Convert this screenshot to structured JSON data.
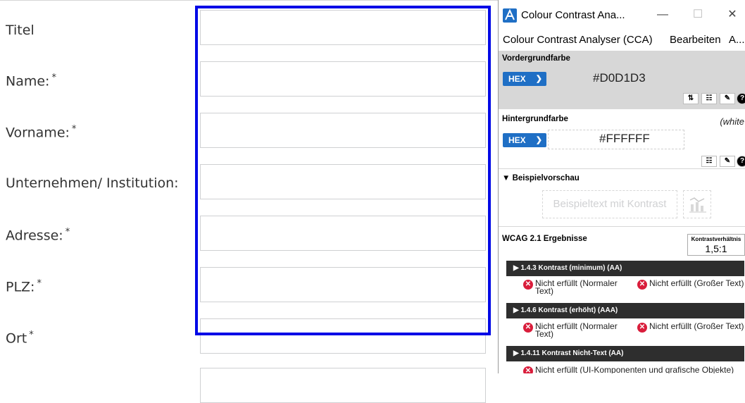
{
  "form": {
    "fields": [
      {
        "label": "Titel",
        "required": false
      },
      {
        "label": "Name:",
        "required": true
      },
      {
        "label": "Vorname:",
        "required": true
      },
      {
        "label": "Unternehmen/ Institution:",
        "required": false
      },
      {
        "label": "Adresse:",
        "required": true
      },
      {
        "label": "PLZ:",
        "required": true
      },
      {
        "label": "Ort",
        "required": true
      }
    ],
    "required_marker": "*",
    "focus_color": "#0009e6"
  },
  "cca": {
    "title": "Colour Contrast Ana...",
    "window_buttons": {
      "minimize": "—",
      "maximize": "☐",
      "close": "✕"
    },
    "menu": [
      "Colour Contrast Analyser (CCA)",
      "Bearbeiten",
      "A..."
    ],
    "foreground": {
      "title": "Vordergrundfarbe",
      "format": "HEX",
      "value": "#D0D1D3",
      "tools": [
        "⇅",
        "☷",
        "✎",
        "?"
      ]
    },
    "background": {
      "title": "Hintergrundfarbe",
      "note": "(white",
      "format": "HEX",
      "value": "#FFFFFF",
      "tools": [
        "☷",
        "✎",
        "?"
      ]
    },
    "preview": {
      "title": "▼ Beispielvorschau",
      "sample_text": "Beispieltext mit Kontrast"
    },
    "wcag": {
      "title": "WCAG 2.1 Ergebnisse",
      "ratio_label": "Kontrastverhältnis",
      "ratio_value": "1,5:1",
      "criteria": [
        {
          "label": "▶  1.4.3 Kontrast (minimum) (AA)",
          "results": [
            "Nicht erfüllt (Normaler Text)",
            "Nicht erfüllt (Großer Text)"
          ]
        },
        {
          "label": "▶  1.4.6 Kontrast (erhöht) (AAA)",
          "results": [
            "Nicht erfüllt (Normaler Text)",
            "Nicht erfüllt (Großer Text)"
          ]
        },
        {
          "label": "▶  1.4.11 Kontrast Nicht-Text (AA)",
          "results": [
            "Nicht erfüllt (UI-Komponenten und grafische Objekte)"
          ]
        }
      ]
    },
    "colors": {
      "accent": "#1f6fc5",
      "fail": "#d91d3b",
      "panel_grey": "#d7d7d7",
      "bar_dark": "#2e2e2e"
    }
  }
}
